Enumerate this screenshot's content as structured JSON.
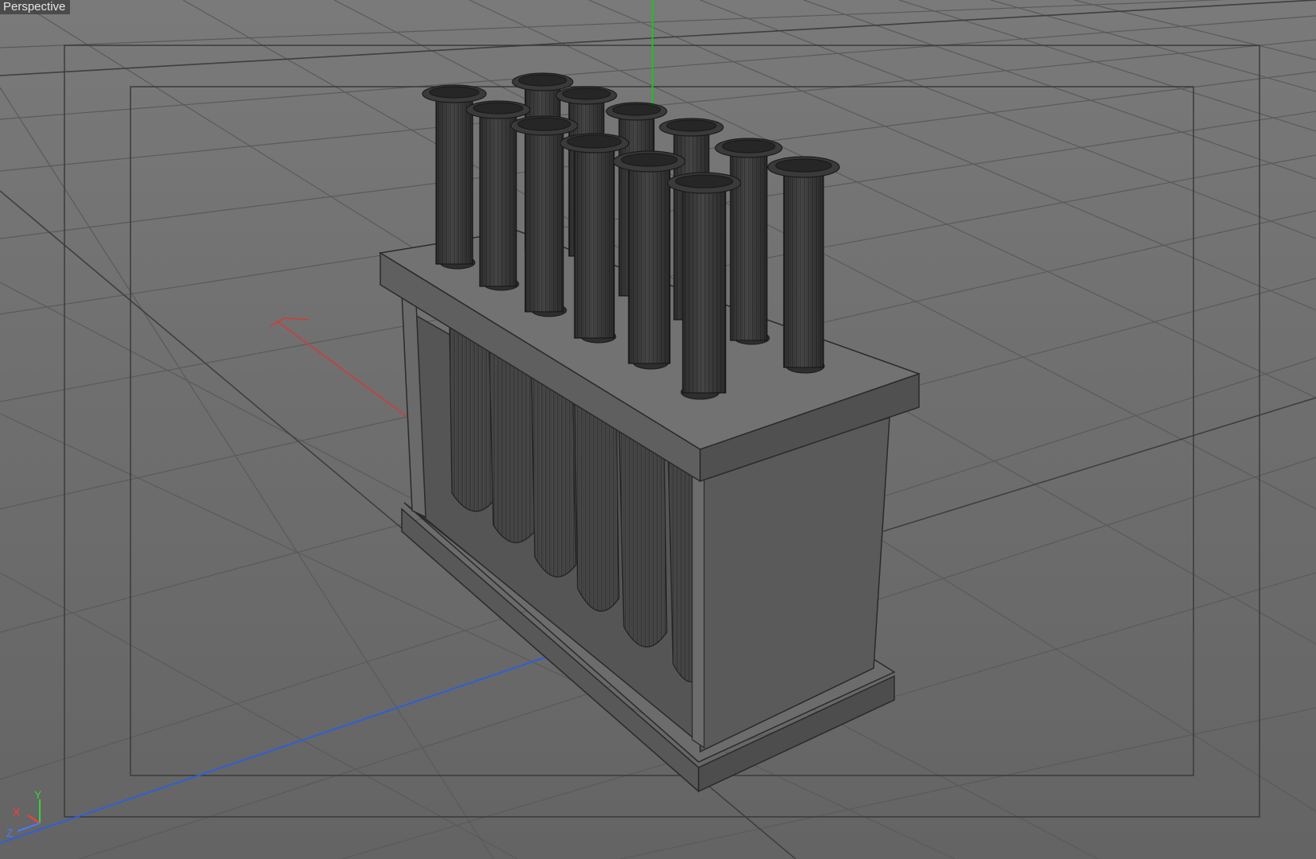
{
  "viewport": {
    "label": "Perspective",
    "axis_gizmo": {
      "x": {
        "label": "X",
        "color": "#ff3b3b"
      },
      "y": {
        "label": "Y",
        "color": "#3bd13b"
      },
      "z": {
        "label": "Z",
        "color": "#4a78ff"
      }
    },
    "axis_colors": {
      "x_axis": "#d23a3a",
      "y_axis": "#19c419",
      "z_axis": "#2f5fd6"
    },
    "scene_object": "test-tube-rack",
    "tube_count": 12
  }
}
